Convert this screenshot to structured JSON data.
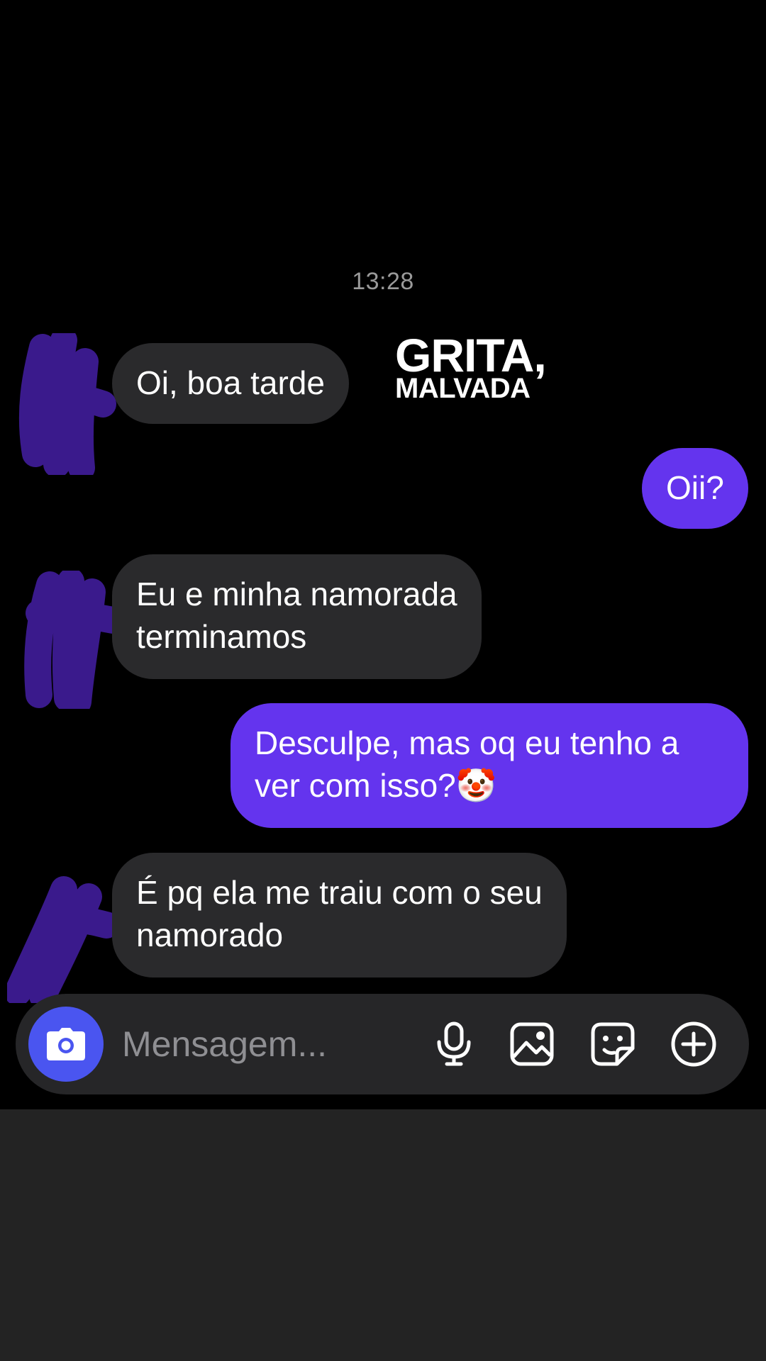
{
  "conversation": {
    "timestamp": "13:28",
    "messages": [
      {
        "direction": "incoming",
        "lines": [
          "Oi, boa tarde"
        ]
      },
      {
        "direction": "outgoing",
        "lines": [
          "Oii?"
        ]
      },
      {
        "direction": "incoming",
        "lines": [
          "Eu e minha namorada",
          "terminamos"
        ]
      },
      {
        "direction": "outgoing",
        "lines": [
          "Desculpe, mas oq eu tenho a",
          "ver com isso?🤡"
        ]
      },
      {
        "direction": "incoming",
        "lines": [
          "É pq ela me traiu com o seu",
          "namorado"
        ]
      }
    ]
  },
  "watermark": {
    "line1": "GRITA,",
    "line2": "MALVADA"
  },
  "composer": {
    "placeholder": "Mensagem...",
    "icons": [
      "camera-icon",
      "microphone-icon",
      "gallery-icon",
      "sticker-icon",
      "add-circle-icon"
    ]
  },
  "colors": {
    "background": "#000000",
    "incoming_bubble": "#2a2a2c",
    "outgoing_bubble": "#6434ee",
    "camera_button": "#4a55f0",
    "scribble": "#3a1a8c"
  }
}
